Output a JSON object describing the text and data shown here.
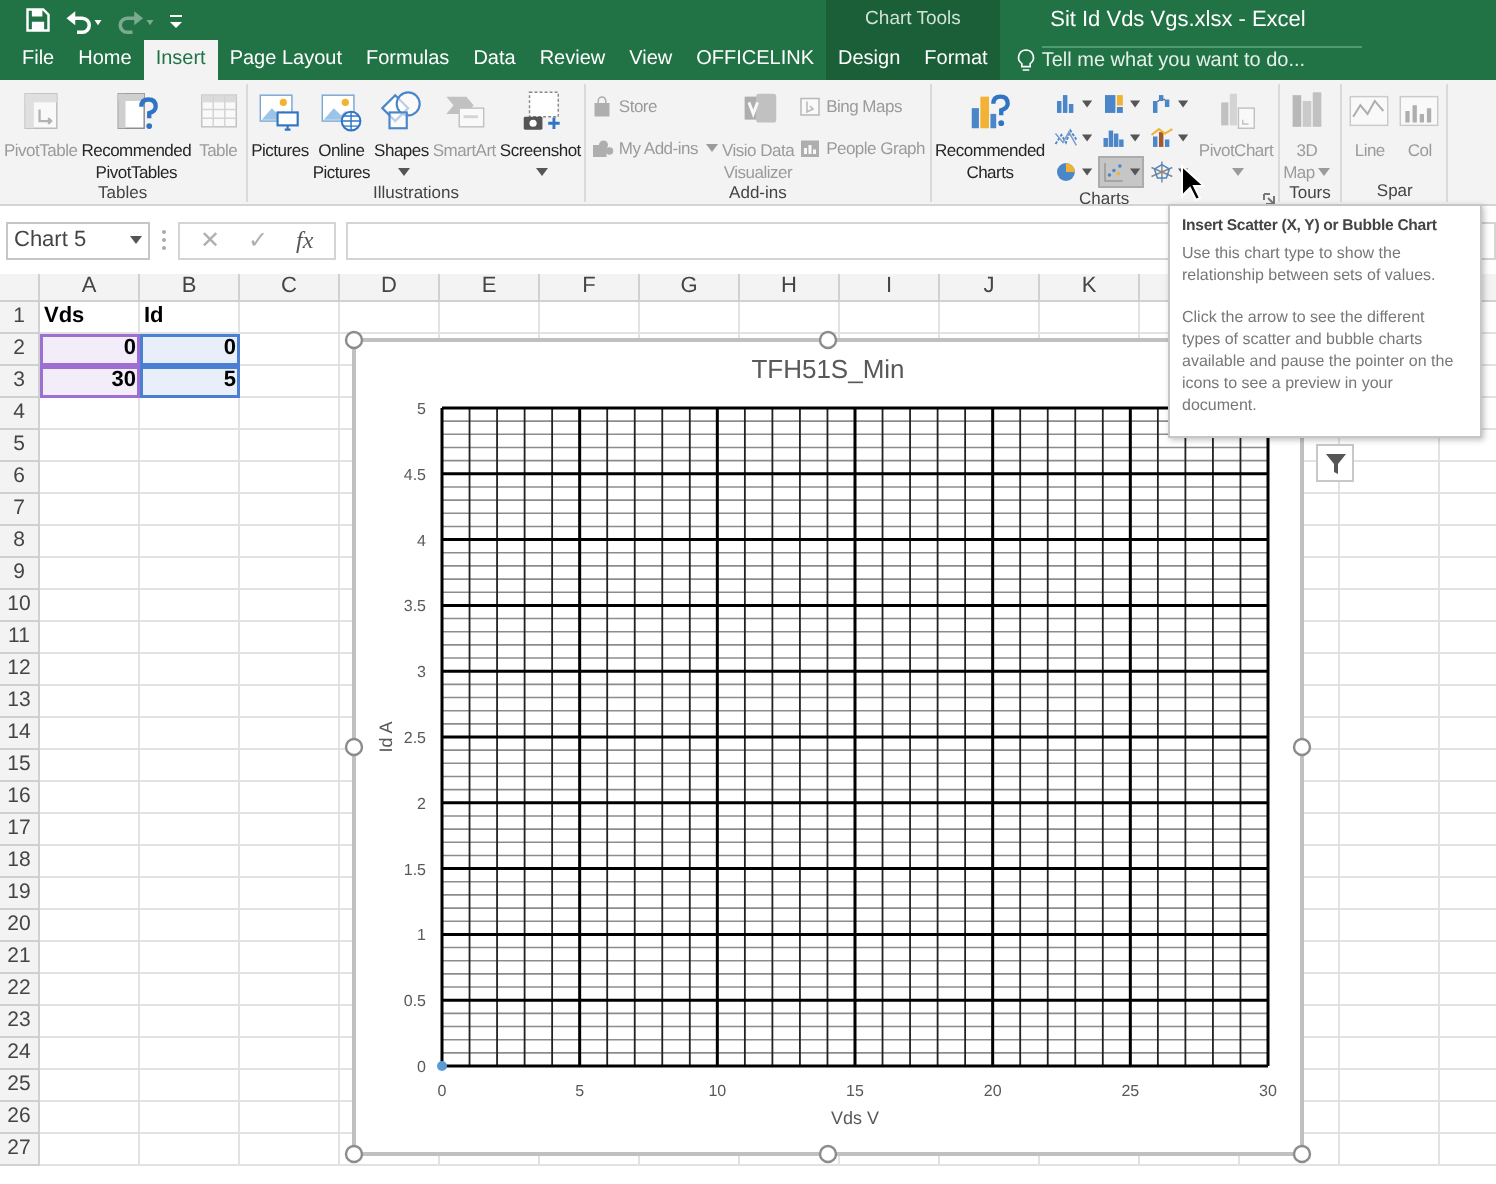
{
  "title_bar": {
    "context_label": "Chart Tools",
    "title": "Sit Id Vds Vgs.xlsx - Excel"
  },
  "quick_access": [
    {
      "kind": "save",
      "disabled": false
    },
    {
      "kind": "undo",
      "disabled": false
    },
    {
      "kind": "redo",
      "disabled": true
    },
    {
      "kind": "customize",
      "disabled": false
    }
  ],
  "tabs": [
    {
      "label": "File",
      "selected": false,
      "contextual": false
    },
    {
      "label": "Home",
      "selected": false,
      "contextual": false
    },
    {
      "label": "Insert",
      "selected": true,
      "contextual": false
    },
    {
      "label": "Page Layout",
      "selected": false,
      "contextual": false
    },
    {
      "label": "Formulas",
      "selected": false,
      "contextual": false
    },
    {
      "label": "Data",
      "selected": false,
      "contextual": false
    },
    {
      "label": "Review",
      "selected": false,
      "contextual": false
    },
    {
      "label": "View",
      "selected": false,
      "contextual": false
    },
    {
      "label": "OFFICELINK",
      "selected": false,
      "contextual": false
    },
    {
      "label": "Design",
      "selected": false,
      "contextual": true
    },
    {
      "label": "Format",
      "selected": false,
      "contextual": true
    }
  ],
  "tell_me": {
    "placeholder": "Tell me what you want to do..."
  },
  "ribbon_groups": [
    {
      "label": "Tables",
      "launcher": false,
      "items": [
        {
          "kind": "pivot-table",
          "lines": [
            "PivotTable"
          ],
          "disabled": true,
          "dropdown": false
        },
        {
          "kind": "recommended-pivot",
          "lines": [
            "Recommended",
            "PivotTables"
          ],
          "disabled": false,
          "dropdown": false
        },
        {
          "kind": "table",
          "lines": [
            "Table"
          ],
          "disabled": true,
          "dropdown": false
        }
      ]
    },
    {
      "label": "Illustrations",
      "launcher": false,
      "items": [
        {
          "kind": "pictures",
          "lines": [
            "Pictures"
          ],
          "disabled": false,
          "dropdown": false
        },
        {
          "kind": "online-pictures",
          "lines": [
            "Online",
            "Pictures"
          ],
          "disabled": false,
          "dropdown": false
        },
        {
          "kind": "shapes",
          "lines": [
            "Shapes"
          ],
          "disabled": false,
          "dropdown": true
        },
        {
          "kind": "smartart",
          "lines": [
            "SmartArt"
          ],
          "disabled": true,
          "dropdown": false
        },
        {
          "kind": "screenshot",
          "lines": [
            "Screenshot"
          ],
          "disabled": false,
          "dropdown": true
        }
      ]
    },
    {
      "label": "Add-ins",
      "launcher": false,
      "items": [
        {
          "stack": [
            {
              "kind": "store",
              "label": "Store",
              "disabled": true,
              "dropdown": false
            },
            {
              "kind": "add-ins",
              "label": "My Add-ins",
              "disabled": true,
              "dropdown": true
            }
          ]
        },
        {
          "kind": "visio",
          "lines": [
            "Visio Data",
            "Visualizer"
          ],
          "disabled": true,
          "dropdown": false
        },
        {
          "stack": [
            {
              "kind": "bing-maps",
              "label": "Bing Maps",
              "disabled": true,
              "dropdown": false
            },
            {
              "kind": "people-graph",
              "label": "People Graph",
              "disabled": true,
              "dropdown": false
            }
          ]
        }
      ]
    },
    {
      "label": "Charts",
      "launcher": true,
      "items": [
        {
          "kind": "recommended-charts",
          "lines": [
            "Recommended",
            "Charts"
          ],
          "disabled": false,
          "dropdown": false
        },
        {
          "gallery": [
            {
              "kind": "column",
              "selected": false
            },
            {
              "kind": "treemap",
              "selected": false
            },
            {
              "kind": "waterfall",
              "selected": false
            },
            {
              "kind": "line",
              "selected": false
            },
            {
              "kind": "histogram",
              "selected": false
            },
            {
              "kind": "combo",
              "selected": false
            },
            {
              "kind": "pie",
              "selected": false
            },
            {
              "kind": "scatter",
              "selected": true
            },
            {
              "kind": "radar",
              "selected": false
            }
          ]
        },
        {
          "kind": "pivot-chart",
          "lines": [
            "PivotChart"
          ],
          "disabled": true,
          "dropdown": true
        }
      ]
    },
    {
      "label": "Tours",
      "launcher": false,
      "items": [
        {
          "kind": "map-3d",
          "lines": [
            "3D",
            "Map"
          ],
          "disabled": true,
          "dropdown": true
        }
      ]
    },
    {
      "label": "Spar",
      "launcher": false,
      "items": [
        {
          "kind": "line-spark",
          "lines": [
            "Line"
          ],
          "disabled": true,
          "dropdown": false
        },
        {
          "kind": "column-spark",
          "lines": [
            "Col"
          ],
          "disabled": true,
          "dropdown": false
        }
      ]
    }
  ],
  "formula_bar": {
    "name_box": "Chart 5",
    "cancel": "✕",
    "enter": "✓",
    "function_label": "fx"
  },
  "sheet": {
    "columns": [
      "A",
      "B",
      "C",
      "D",
      "E",
      "F",
      "G",
      "H",
      "I",
      "J",
      "K"
    ],
    "rows": [
      {
        "header": "1",
        "cells": [
          {
            "text": "Vds",
            "bold": true
          },
          {
            "text": "Id",
            "bold": true
          }
        ]
      },
      {
        "header": "2",
        "cells": [
          {
            "text": "0",
            "bold": true,
            "color": "#9d6fd3"
          },
          {
            "text": "0",
            "bold": true,
            "color": "#4a7fd4"
          }
        ]
      },
      {
        "header": "3",
        "cells": [
          {
            "text": "30",
            "bold": true,
            "color": "#9d6fd3"
          },
          {
            "text": "5",
            "bold": true,
            "color": "#4a7fd4"
          }
        ]
      },
      {
        "header": "4"
      },
      {
        "header": "5"
      },
      {
        "header": "6"
      },
      {
        "header": "7"
      },
      {
        "header": "8"
      },
      {
        "header": "9"
      },
      {
        "header": "10"
      },
      {
        "header": "11"
      },
      {
        "header": "12"
      },
      {
        "header": "13"
      },
      {
        "header": "14"
      },
      {
        "header": "15"
      },
      {
        "header": "16"
      },
      {
        "header": "17"
      },
      {
        "header": "18"
      },
      {
        "header": "19"
      },
      {
        "header": "20"
      },
      {
        "header": "21"
      },
      {
        "header": "22"
      },
      {
        "header": "23"
      },
      {
        "header": "24"
      },
      {
        "header": "25"
      },
      {
        "header": "26"
      },
      {
        "header": "27"
      }
    ]
  },
  "chart": {
    "selected": true,
    "chart_data": {
      "type": "scatter",
      "title": "TFH51S_Min",
      "xlabel": "Vds V",
      "ylabel": "Id A",
      "x": [
        0
      ],
      "series": [
        {
          "color": "#5b9bd5",
          "values": [
            0
          ]
        }
      ],
      "xlim": [
        0,
        30
      ],
      "ylim": [
        0,
        5
      ],
      "grid": true,
      "xticks": [
        0,
        5,
        10,
        15,
        20,
        25,
        30
      ],
      "yticks": [
        0,
        0.5,
        1,
        1.5,
        2,
        2.5,
        3,
        3.5,
        4,
        4.5,
        5
      ]
    }
  },
  "tooltip": {
    "title": "Insert Scatter (X, Y) or Bubble Chart",
    "paragraphs": [
      "Use this chart type to show the relationship between sets of values.",
      "Click the arrow to see the different types of scatter and bubble charts available and pause the pointer on the icons to see a preview in your document."
    ]
  }
}
